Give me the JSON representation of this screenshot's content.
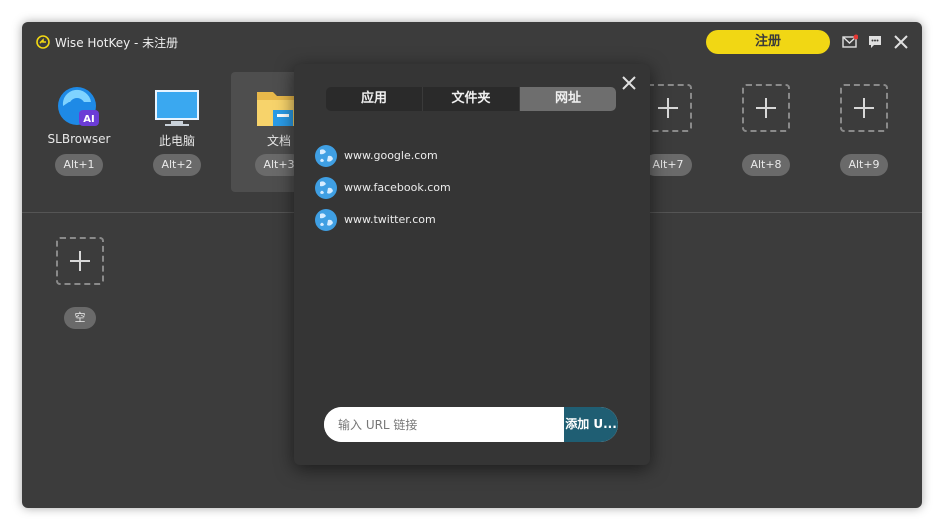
{
  "window": {
    "title": "Wise HotKey - 未注册",
    "register_label": "注册",
    "colors": {
      "background": "#3c3c3c",
      "accent": "#f1d714",
      "popup": "#353535",
      "add_button": "#1f5e73"
    }
  },
  "slots_row1": [
    {
      "label": "SLBrowser",
      "hotkey": "Alt+1",
      "icon": "slbrowser-icon"
    },
    {
      "label": "此电脑",
      "hotkey": "Alt+2",
      "icon": "monitor-icon"
    },
    {
      "label": "文档",
      "hotkey": "Alt+3",
      "icon": "folder-icon"
    },
    {
      "label": "",
      "hotkey": "Alt+7",
      "icon": "add-icon"
    },
    {
      "label": "",
      "hotkey": "Alt+8",
      "icon": "add-icon"
    },
    {
      "label": "",
      "hotkey": "Alt+9",
      "icon": "add-icon"
    }
  ],
  "slots_row2": [
    {
      "hotkey": "空",
      "icon": "add-icon"
    }
  ],
  "popup": {
    "tabs": [
      "应用",
      "文件夹",
      "网址"
    ],
    "active_tab": "网址",
    "urls": [
      "www.google.com",
      "www.facebook.com",
      "www.twitter.com"
    ],
    "input_placeholder": "输入 URL 链接",
    "add_label": "添加 U..."
  }
}
